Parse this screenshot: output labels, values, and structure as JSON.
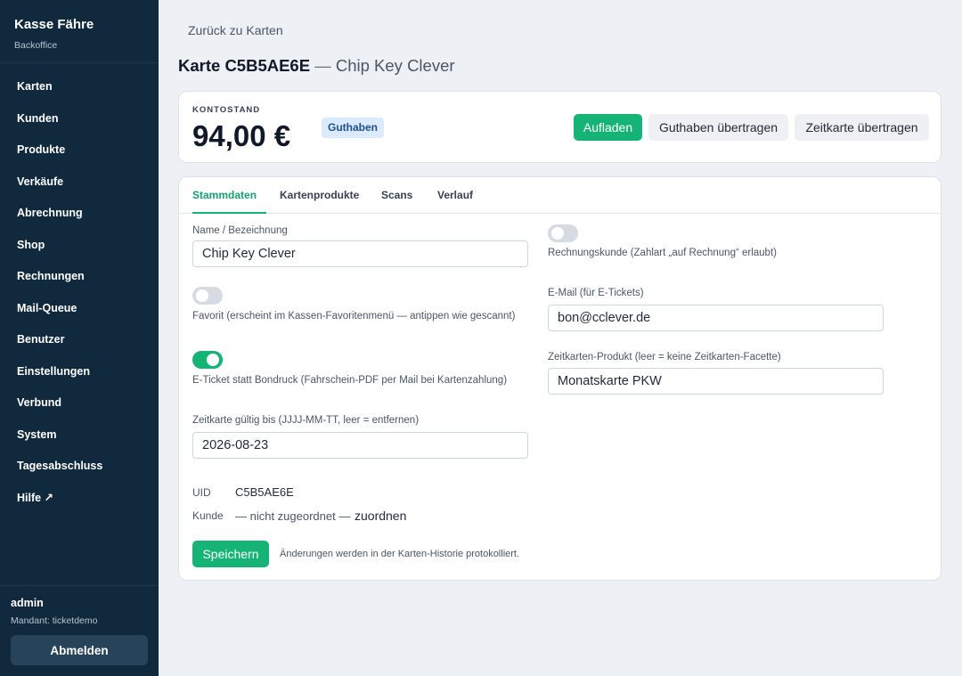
{
  "app": {
    "title": "Kasse Fähre",
    "subtitle": "Backoffice"
  },
  "sidebar": {
    "items": [
      {
        "label": "Karten"
      },
      {
        "label": "Kunden"
      },
      {
        "label": "Produkte"
      },
      {
        "label": "Verkäufe"
      },
      {
        "label": "Abrechnung"
      },
      {
        "label": "Shop"
      },
      {
        "label": "Rechnungen"
      },
      {
        "label": "Mail-Queue"
      },
      {
        "label": "Benutzer"
      },
      {
        "label": "Einstellungen"
      },
      {
        "label": "Verbund"
      },
      {
        "label": "System"
      },
      {
        "label": "Tagesabschluss"
      },
      {
        "label": "Hilfe ↗"
      }
    ]
  },
  "user": {
    "name": "admin",
    "tenant": "Mandant: ticketdemo",
    "logout_label": "Abmelden"
  },
  "header": {
    "back_label": "Zurück zu Karten",
    "title_strong": "Karte C5B5AE6E",
    "title_dash": "—",
    "title_sub": "Chip Key Clever"
  },
  "balance": {
    "label": "KONTOSTAND",
    "value": "94,00 €",
    "badge": "Guthaben",
    "actions": {
      "topup": "Aufladen",
      "transfer_credit": "Guthaben übertragen",
      "transfer_pass": "Zeitkarte übertragen"
    }
  },
  "tabs": [
    {
      "label": "Stammdaten",
      "active": true
    },
    {
      "label": "Kartenprodukte",
      "active": false
    },
    {
      "label": "Scans",
      "active": false
    },
    {
      "label": "Verlauf",
      "active": false
    }
  ],
  "form": {
    "name": {
      "label": "Name / Bezeichnung",
      "value": "Chip Key Clever"
    },
    "favorite": {
      "label": "Favorit (erscheint im Kassen-Favoritenmenü — antippen wie gescannt)",
      "on": false
    },
    "eticket": {
      "label": "E-Ticket statt Bondruck (Fahrschein-PDF per Mail bei Kartenzahlung)",
      "on": true
    },
    "valid_until": {
      "label": "Zeitkarte gültig bis (JJJJ-MM-TT, leer = entfernen)",
      "value": "2026-08-23"
    },
    "invoice_customer": {
      "label": "Rechnungskunde (Zahlart „auf Rechnung“ erlaubt)",
      "on": false
    },
    "email": {
      "label": "E-Mail (für E-Tickets)",
      "value": "bon@cclever.de"
    },
    "pass_product": {
      "label": "Zeitkarten-Produkt (leer = keine Zeitkarten-Facette)",
      "value": "Monatskarte PKW"
    }
  },
  "meta": {
    "uid_label": "UID",
    "uid_value": "C5B5AE6E",
    "customer_label": "Kunde",
    "customer_value": "— nicht zugeordnet —",
    "assign_label": "zuordnen"
  },
  "save": {
    "label": "Speichern",
    "note": "Änderungen werden in der Karten-Historie protokolliert."
  },
  "colors": {
    "sidebar": "#10293c",
    "accent": "#16b377",
    "badge_bg": "#dbeafe"
  }
}
